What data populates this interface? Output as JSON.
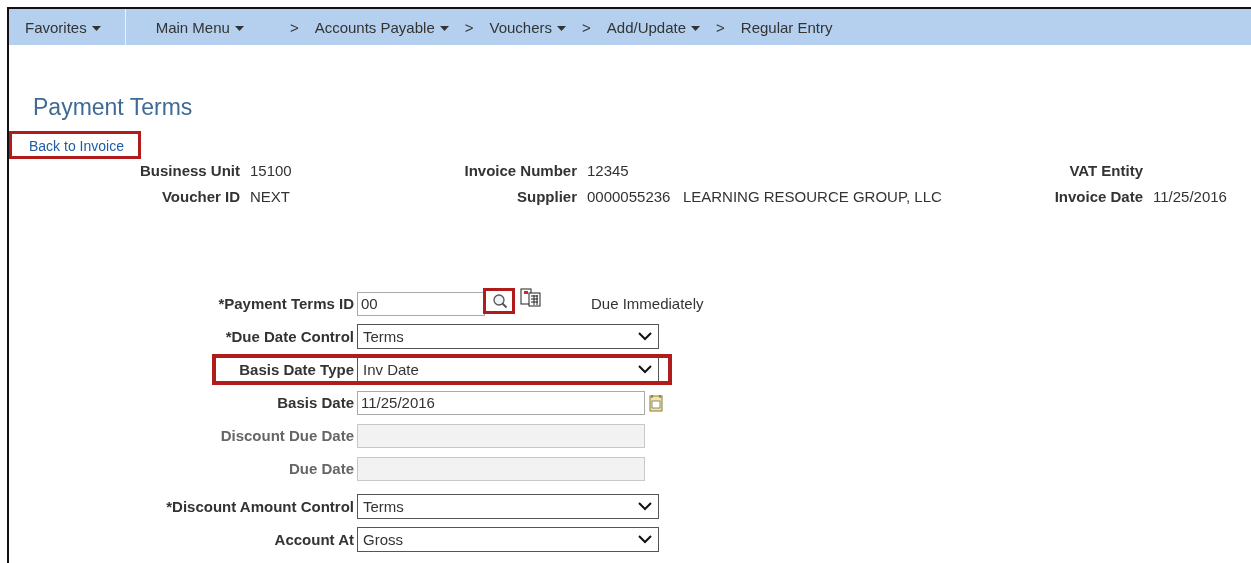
{
  "nav": {
    "favorites": {
      "label": "Favorites",
      "dropdown": true
    },
    "main_menu": {
      "label": "Main Menu",
      "dropdown": true
    },
    "separator": ">",
    "breadcrumb": [
      {
        "label": "Accounts Payable",
        "dropdown": true
      },
      {
        "label": "Vouchers",
        "dropdown": true
      },
      {
        "label": "Add/Update",
        "dropdown": true
      },
      {
        "label": "Regular Entry",
        "dropdown": false
      }
    ]
  },
  "page_title": "Payment Terms",
  "back_link": {
    "label": "Back to Invoice",
    "highlighted": true
  },
  "header": [
    [
      {
        "label": "Business Unit",
        "value": "15100"
      },
      {
        "label": "Invoice Number",
        "value": "12345"
      },
      {
        "label": "VAT Entity"
      }
    ],
    [
      {
        "label": "Voucher ID",
        "value": "NEXT"
      },
      {
        "label": "Supplier",
        "value": "0000055236   LEARNING RESOURCE GROUP, LLC"
      },
      {
        "label": "Invoice Date",
        "value": "11/25/2016"
      }
    ]
  ],
  "form": [
    {
      "kind": "lookup",
      "label": "*Payment Terms ID",
      "value": "00",
      "lookup_highlighted": true,
      "description": "Due Immediately",
      "highlighted": false
    },
    {
      "kind": "select",
      "label": "*Due Date Control",
      "value": "Terms",
      "highlighted": false
    },
    {
      "kind": "select",
      "label": "Basis Date Type",
      "value": "Inv Date",
      "highlighted": true
    },
    {
      "kind": "date",
      "label": "Basis Date",
      "value": "11/25/2016",
      "highlighted": false
    },
    {
      "kind": "disabled",
      "label": "Discount Due Date",
      "highlighted": false
    },
    {
      "kind": "disabled",
      "label": "Due Date",
      "highlighted": false
    },
    {
      "kind": "select",
      "label": "*Discount Amount Control",
      "value": "Terms",
      "highlighted": false,
      "spaced": true
    },
    {
      "kind": "select",
      "label": "Account At",
      "value": "Gross",
      "highlighted": false
    }
  ]
}
